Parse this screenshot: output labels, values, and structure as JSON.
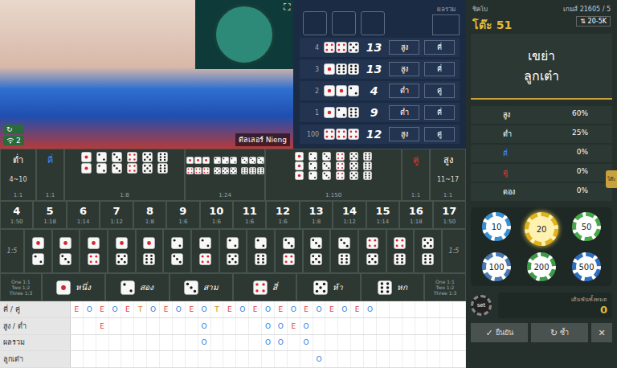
{
  "video": {
    "dealer_label": "ดีลเลอร์ Nieng",
    "signal": "2",
    "refresh_icon": "↻",
    "expand_icon": "⛶"
  },
  "current": {
    "total_label": "ผลรวม"
  },
  "history": [
    {
      "round": "4",
      "dice": [
        4,
        4,
        5
      ],
      "total": "13",
      "size": "สูง",
      "parity": "คี่"
    },
    {
      "round": "3",
      "dice": [
        1,
        6,
        6
      ],
      "total": "13",
      "size": "สูง",
      "parity": "คี่"
    },
    {
      "round": "2",
      "dice": [
        1,
        1,
        2
      ],
      "total": "4",
      "size": "ต่ำ",
      "parity": "คู่"
    },
    {
      "round": "1",
      "dice": [
        1,
        2,
        6
      ],
      "total": "9",
      "size": "ต่ำ",
      "parity": "คี่"
    },
    {
      "round": "100",
      "dice": [
        4,
        4,
        4
      ],
      "total": "12",
      "size": "สูง",
      "parity": "คู่"
    }
  ],
  "board": {
    "small": {
      "label": "ต่ำ",
      "range": "4~10",
      "payout": "1:1"
    },
    "odd": {
      "label": "คี่",
      "payout": "1:1"
    },
    "doubles": {
      "values": [
        1,
        2,
        3,
        4,
        5,
        6
      ],
      "payout": "1:8"
    },
    "any_triple": {
      "values": [
        1,
        2,
        3,
        4,
        5,
        6
      ],
      "payout": "1:24"
    },
    "triples": {
      "values": [
        1,
        2,
        3,
        4,
        5,
        6
      ],
      "payout": "1:150"
    },
    "even": {
      "label": "คู่",
      "payout": "1:1"
    },
    "big": {
      "label": "สูง",
      "range": "11~17",
      "payout": "1:1"
    },
    "totals": [
      {
        "total": "4",
        "payout": "1:50"
      },
      {
        "total": "5",
        "payout": "1:18"
      },
      {
        "total": "6",
        "payout": "1:14"
      },
      {
        "total": "7",
        "payout": "1:12"
      },
      {
        "total": "8",
        "payout": "1:8"
      },
      {
        "total": "9",
        "payout": "1:6"
      },
      {
        "total": "10",
        "payout": "1:6"
      },
      {
        "total": "11",
        "payout": "1:6"
      },
      {
        "total": "12",
        "payout": "1:6"
      },
      {
        "total": "13",
        "payout": "1:8"
      },
      {
        "total": "14",
        "payout": "1:12"
      },
      {
        "total": "15",
        "payout": "1:14"
      },
      {
        "total": "16",
        "payout": "1:18"
      },
      {
        "total": "17",
        "payout": "1:50"
      }
    ],
    "combo_payout": "1:5",
    "combos": [
      [
        1,
        2
      ],
      [
        1,
        3
      ],
      [
        1,
        4
      ],
      [
        1,
        5
      ],
      [
        1,
        6
      ],
      [
        2,
        3
      ],
      [
        2,
        4
      ],
      [
        2,
        5
      ],
      [
        2,
        6
      ],
      [
        3,
        4
      ],
      [
        3,
        5
      ],
      [
        3,
        6
      ],
      [
        4,
        5
      ],
      [
        4,
        6
      ],
      [
        5,
        6
      ]
    ],
    "single_payouts": [
      "One 1:1",
      "Two 1:2",
      "Three 1:3"
    ],
    "singles": [
      {
        "value": 1,
        "label": "หนึ่ง"
      },
      {
        "value": 2,
        "label": "สอง"
      },
      {
        "value": 3,
        "label": "สาม"
      },
      {
        "value": 4,
        "label": "สี่"
      },
      {
        "value": 5,
        "label": "ห้า"
      },
      {
        "value": 6,
        "label": "หก"
      }
    ]
  },
  "roadmap": [
    {
      "label": "คี่ / คู่",
      "cells": [
        "E",
        "O",
        "E",
        "O",
        "E",
        "T",
        "O",
        "E",
        "O",
        "E",
        "O",
        "T",
        "E",
        "O",
        "E",
        "O",
        "E",
        "O",
        "E",
        "O",
        "E",
        "O",
        "E",
        "O",
        "",
        "",
        "",
        "",
        "",
        "",
        ""
      ]
    },
    {
      "label": "สูง / ต่ำ",
      "cells": [
        "",
        "",
        "E",
        "",
        "",
        "",
        "",
        "",
        "",
        "",
        "O",
        "",
        "",
        "",
        "",
        "O",
        "O",
        "E",
        "O",
        "",
        "",
        "",
        "",
        "",
        "",
        "",
        "",
        "",
        "",
        "",
        ""
      ]
    },
    {
      "label": "ผลรวม",
      "cells": [
        "",
        "",
        "",
        "",
        "",
        "",
        "",
        "",
        "",
        "",
        "O",
        "",
        "",
        "",
        "",
        "O",
        "O",
        "",
        "O",
        "",
        "",
        "",
        "",
        "",
        "",
        "",
        "",
        "",
        "",
        "",
        ""
      ]
    },
    {
      "label": "ลูกเต๋า",
      "cells": [
        "",
        "",
        "",
        "",
        "",
        "",
        "",
        "",
        "",
        "",
        "",
        "",
        "",
        "",
        "",
        "",
        "",
        "",
        "",
        "O",
        "",
        "",
        "",
        "",
        "",
        "",
        "",
        "",
        "",
        "",
        ""
      ]
    }
  ],
  "game": {
    "name": "ชิคโบ",
    "table": "โต๊ะ 51",
    "round": "เกมส์ 21605 / 5",
    "limit_icon": "⇅",
    "limit": "20-5K"
  },
  "status": [
    "เขย่า",
    "ลูกเต๋า"
  ],
  "stats": [
    {
      "label": "สูง",
      "value": "60%",
      "color": "#ffffff"
    },
    {
      "label": "ต่ำ",
      "value": "25%",
      "color": "#ffffff"
    },
    {
      "label": "คี่",
      "value": "0%",
      "color": "#3b8cff"
    },
    {
      "label": "คู่",
      "value": "0%",
      "color": "#e53935"
    },
    {
      "label": "ตอง",
      "value": "0%",
      "color": "#ffffff"
    }
  ],
  "side_tab": "โต๊ะ",
  "chips": [
    {
      "value": "10",
      "selected": false,
      "color": "#3a8fd0"
    },
    {
      "value": "20",
      "selected": true,
      "color": "#e2b21c"
    },
    {
      "value": "50",
      "selected": false,
      "color": "#49a84a"
    },
    {
      "value": "100",
      "selected": false,
      "color": "#4a78b0"
    },
    {
      "value": "200",
      "selected": false,
      "color": "#3f9a4a"
    },
    {
      "value": "500",
      "selected": false,
      "color": "#2f6fc0"
    }
  ],
  "set_chip": "set",
  "total_bet": {
    "label": "เดิมพันทั้งหมด",
    "value": "0"
  },
  "buttons": [
    {
      "icon": "✓",
      "label": "ยืนยัน"
    },
    {
      "icon": "↻",
      "label": "ซ้ำ"
    },
    {
      "icon": "✕",
      "label": ""
    }
  ]
}
